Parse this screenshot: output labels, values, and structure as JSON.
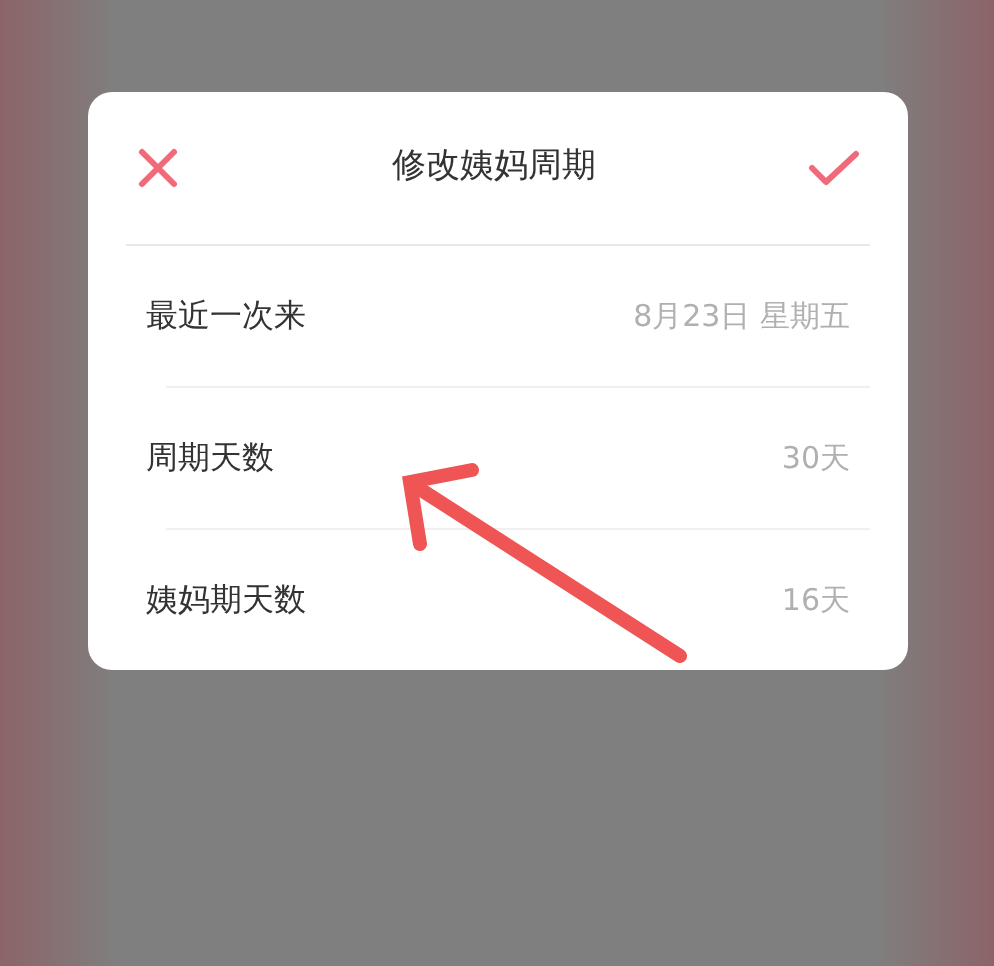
{
  "dialog": {
    "title": "修改姨妈周期"
  },
  "rows": [
    {
      "label": "最近一次来",
      "value": "8月23日 星期五"
    },
    {
      "label": "周期天数",
      "value": "30天"
    },
    {
      "label": "姨妈期天数",
      "value": "16天"
    }
  ]
}
